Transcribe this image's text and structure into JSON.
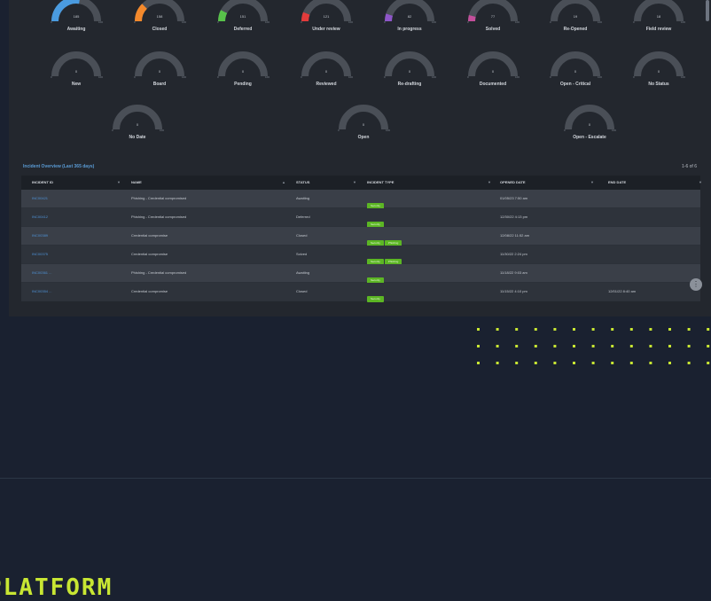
{
  "gauges": [
    {
      "label": "Awaiting",
      "value": "185",
      "color": "#4a9be0",
      "fill": 0.55
    },
    {
      "label": "Closed",
      "value": "158",
      "color": "#f3892c",
      "fill": 0.25
    },
    {
      "label": "Deferred",
      "value": "151",
      "color": "#58c24a",
      "fill": 0.15
    },
    {
      "label": "Under review",
      "value": "121",
      "color": "#e23b3b",
      "fill": 0.12
    },
    {
      "label": "In progress",
      "value": "82",
      "color": "#8e56c9",
      "fill": 0.1
    },
    {
      "label": "Solved",
      "value": "77",
      "color": "#c34f9b",
      "fill": 0.08
    },
    {
      "label": "Re-Opened",
      "value": "19",
      "color": "#7a828e",
      "fill": 0
    },
    {
      "label": "Field review",
      "value": "18",
      "color": "#7a828e",
      "fill": 0
    },
    {
      "label": "New",
      "value": "0",
      "color": "#7a828e",
      "fill": 0
    },
    {
      "label": "Board",
      "value": "0",
      "color": "#7a828e",
      "fill": 0
    },
    {
      "label": "Pending",
      "value": "0",
      "color": "#7a828e",
      "fill": 0
    },
    {
      "label": "Reviewed",
      "value": "0",
      "color": "#7a828e",
      "fill": 0
    },
    {
      "label": "Re-drafting",
      "value": "0",
      "color": "#7a828e",
      "fill": 0
    },
    {
      "label": "Documented",
      "value": "0",
      "color": "#7a828e",
      "fill": 0
    },
    {
      "label": "Open - Critical",
      "value": "0",
      "color": "#7a828e",
      "fill": 0
    },
    {
      "label": "No Status",
      "value": "0",
      "color": "#7a828e",
      "fill": 0
    },
    {
      "label": "No Date",
      "value": "0",
      "color": "#7a828e",
      "fill": 0
    },
    {
      "label": "Open",
      "value": "0",
      "color": "#7a828e",
      "fill": 0
    },
    {
      "label": "Open - Escalate",
      "value": "0",
      "color": "#7a828e",
      "fill": 0
    }
  ],
  "gauge_scale": {
    "min": "0",
    "max": "100"
  },
  "table": {
    "title": "Incident Overview (Last 365 days)",
    "count": "1-6 of 6",
    "columns": [
      "INCIDENT ID",
      "NAME",
      "STATUS",
      "INCIDENT TYPE",
      "OPENED DATE",
      "END DATE"
    ],
    "rows": [
      {
        "id": "INC00421",
        "name": "Phishing - Credential compromised",
        "status": "Awaiting",
        "tags": [
          "Security"
        ],
        "opened": "01/05/23 7:50 am",
        "end": ""
      },
      {
        "id": "INC00412",
        "name": "Phishing - Credential compromised",
        "status": "Deferred",
        "tags": [
          "Security"
        ],
        "opened": "12/30/22 4:13 pm",
        "end": ""
      },
      {
        "id": "INC00389",
        "name": "Credential compromise",
        "status": "Closed",
        "tags": [
          "Security",
          "Phishing"
        ],
        "opened": "12/08/22 11:52 am",
        "end": ""
      },
      {
        "id": "INC00375",
        "name": "Credential compromise",
        "status": "Solved",
        "tags": [
          "Security",
          "Phishing"
        ],
        "opened": "11/30/22 2:24 pm",
        "end": ""
      },
      {
        "id": "INC00361 ... ",
        "name": "Phishing - Credential compromised",
        "status": "Awaiting",
        "tags": [
          "Security"
        ],
        "opened": "11/18/22 9:03 am",
        "end": ""
      },
      {
        "id": "INC00354 ... ",
        "name": "Credential compromise",
        "status": "Closed",
        "tags": [
          "Security"
        ],
        "opened": "11/15/22 4:10 pm",
        "end": "12/01/22 8:40 am"
      }
    ]
  },
  "footer": {
    "brand": "PLATFORM"
  }
}
